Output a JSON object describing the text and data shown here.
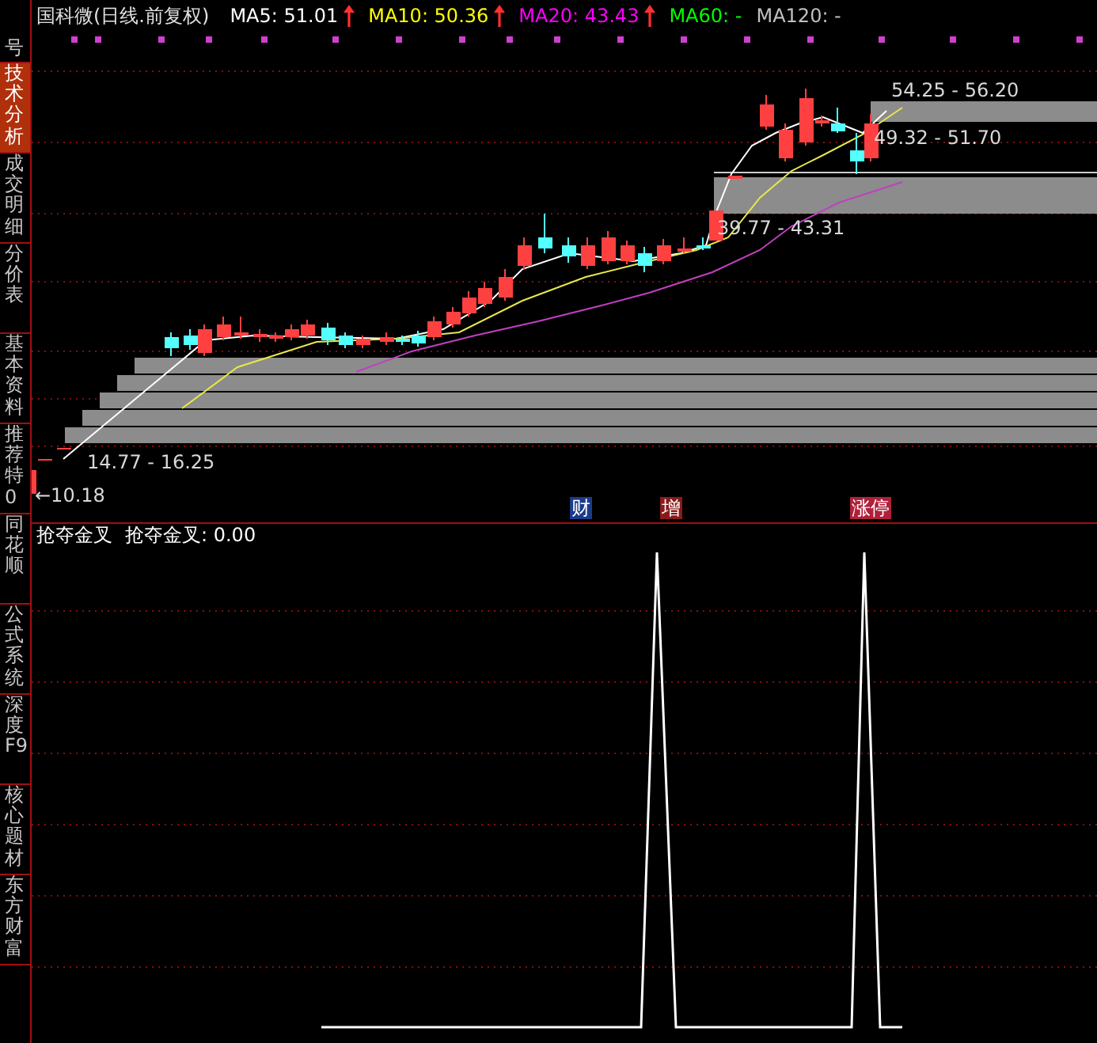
{
  "sidebar": {
    "tabs": [
      {
        "label": "号",
        "selected": false
      },
      {
        "label": "技术分析",
        "selected": true
      },
      {
        "label": "成交明细",
        "selected": false
      },
      {
        "label": "分价表",
        "selected": false
      },
      {
        "label": "基本资料",
        "selected": false
      },
      {
        "label": "推荐特0",
        "selected": false
      },
      {
        "label": "同花顺",
        "selected": false
      },
      {
        "label": "公式系统",
        "selected": false
      },
      {
        "label": "深度F9",
        "selected": false
      },
      {
        "label": "核心题材",
        "selected": false
      },
      {
        "label": "东方财富",
        "selected": false
      }
    ]
  },
  "window": {
    "title": "国科微(日线.前复权)"
  },
  "ma_legend": [
    {
      "label": "MA5: 51.01",
      "color": "#ffffff",
      "rising": true
    },
    {
      "label": "MA10: 50.36",
      "color": "#ffff00",
      "rising": true
    },
    {
      "label": "MA20: 43.43",
      "color": "#ff00ff",
      "rising": true
    },
    {
      "label": "MA60: -",
      "color": "#00ff00",
      "rising": false
    },
    {
      "label": "MA120: -",
      "color": "#c0c0c0",
      "rising": false
    }
  ],
  "price_chart": {
    "range_labels": [
      "54.25 - 56.20",
      "49.32 - 51.70",
      "39.77 - 43.31",
      "14.77 - 16.25"
    ],
    "low_label": "←10.18"
  },
  "event_markers": [
    {
      "label": "财",
      "color": "#1a3a8a"
    },
    {
      "label": "增",
      "color": "#8a1a1a"
    },
    {
      "label": "涨停",
      "color": "#b0203a"
    }
  ],
  "indicator": {
    "name": "抢夺金叉",
    "value_label": "抢夺金叉: 0.00"
  }
}
